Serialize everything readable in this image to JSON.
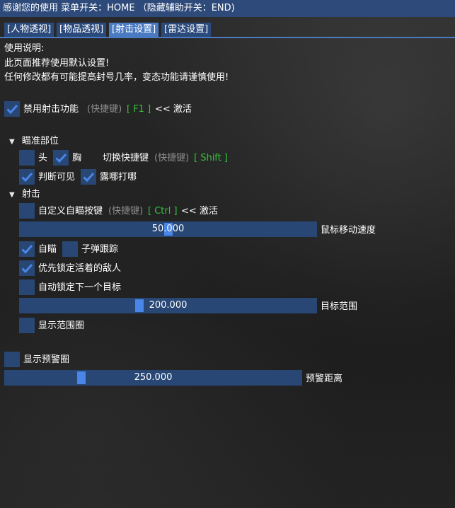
{
  "window": {
    "title": "感谢您的使用 菜单开关：HOME （隐藏辅助开关：END)"
  },
  "tabs": [
    {
      "label": "[人物透视]",
      "active": false
    },
    {
      "label": "[物品透视]",
      "active": false
    },
    {
      "label": "[射击设置]",
      "active": true
    },
    {
      "label": "[雷达设置]",
      "active": false
    }
  ],
  "intro": {
    "line1": "使用说明:",
    "line2": "此页面推荐使用默认设置!",
    "line3": "任何修改都有可能提高封号几率，变态功能请谨慎使用!"
  },
  "disable_shoot": {
    "label": "禁用射击功能",
    "hotkey_label": "(快捷键)",
    "hotkey": "[ F1 ]",
    "activate": "<< 激活",
    "checked": true
  },
  "aim_part": {
    "header": "瞄准部位",
    "expanded": true,
    "head": {
      "label": "头",
      "checked": false
    },
    "chest": {
      "label": "胸",
      "checked": true
    },
    "switch_label": "切换快捷键",
    "switch_hotkey_label": "(快捷键)",
    "switch_hotkey": "[ Shift ]",
    "visible_check": {
      "label": "判断可见",
      "checked": true
    },
    "exposed_hit": {
      "label": "露哪打哪",
      "checked": true
    }
  },
  "shoot": {
    "header": "射击",
    "expanded": true,
    "custom_aim_key": {
      "label": "自定义自瞄按键",
      "hotkey_label": "(快捷键)",
      "hotkey": "[ Ctrl ]",
      "activate": "<< 激活",
      "checked": false
    },
    "mouse_speed": {
      "value": 50.0,
      "display": "50.000",
      "min": 0,
      "max": 100,
      "label": "鼠标移动速度"
    },
    "auto_aim": {
      "label": "自瞄",
      "checked": true
    },
    "bullet_track": {
      "label": "子弹跟踪",
      "checked": false
    },
    "prefer_alive": {
      "label": "优先锁定活着的敌人",
      "checked": true
    },
    "auto_next": {
      "label": "自动锁定下一个目标",
      "checked": false
    },
    "target_range": {
      "value": 200.0,
      "display": "200.000",
      "min": 0,
      "max": 500,
      "label": "目标范围"
    },
    "show_range_circle": {
      "label": "显示范围圈",
      "checked": false
    }
  },
  "warning": {
    "show_circle": {
      "label": "显示预警圈",
      "checked": false
    },
    "distance": {
      "value": 250.0,
      "display": "250.000",
      "min": 0,
      "max": 1000,
      "label": "预警距离"
    }
  },
  "colors": {
    "title_bg": "#2e4a7a",
    "accent": "#4a86e8",
    "frame": "#284774",
    "hotkey_green": "#35c43a"
  }
}
